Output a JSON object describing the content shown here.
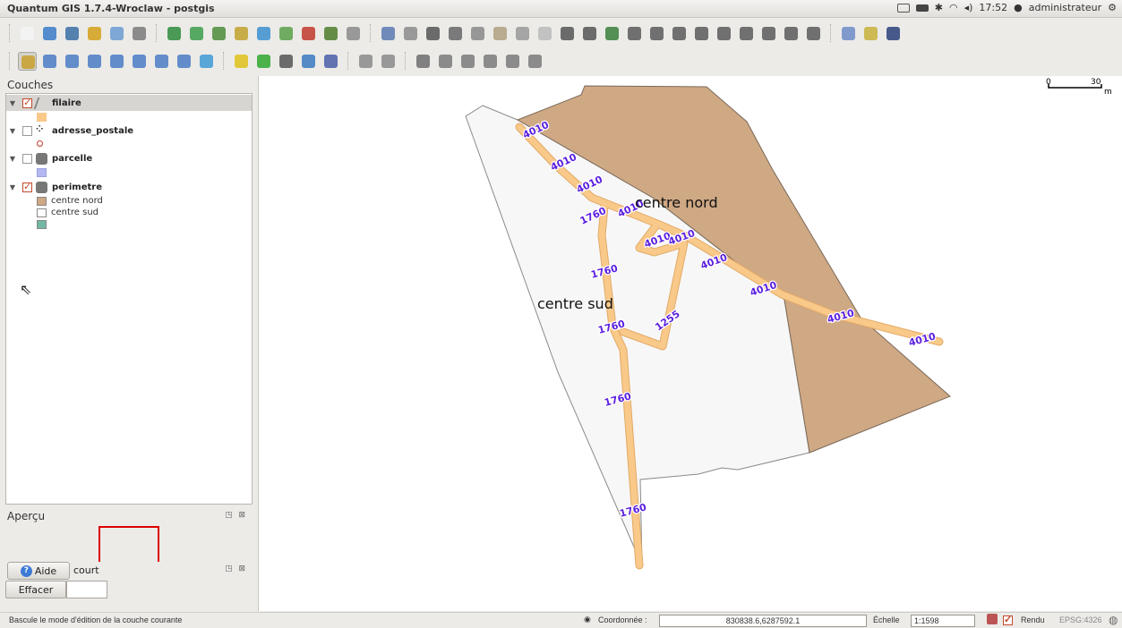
{
  "window": {
    "title": "Quantum GIS 1.7.4-Wroclaw - postgis"
  },
  "tray": {
    "time": "17:52",
    "user": "administrateur"
  },
  "toolbar1": {
    "icons": [
      "new-project-icon",
      "open-project-icon",
      "save-project-icon",
      "save-as-icon",
      "print-composer-icon",
      "print-icon",
      "add-vector-icon",
      "add-raster-icon",
      "add-postgis-icon",
      "add-spatialite-icon",
      "add-wms-icon",
      "new-shapefile-icon",
      "remove-layer-icon",
      "add-wfs-icon",
      "add-gps-icon",
      "toggle-edit-icon",
      "save-edits-icon",
      "move-feature-icon",
      "node-tool-icon",
      "delete-selected-icon",
      "cut-icon",
      "copy-icon",
      "paste-icon",
      "undo-icon",
      "redo-icon",
      "add-ring-icon",
      "add-part-icon",
      "fill-ring-icon",
      "delete-ring-icon",
      "delete-part-icon",
      "reshape-icon",
      "split-icon",
      "merge-icon",
      "merge-attributes-icon",
      "rotate-icon",
      "plugin-icon",
      "select-icon",
      "whats-this-icon"
    ],
    "colors": [
      "#f5f5f5",
      "#3b7bc8",
      "#3b6ea5",
      "#d4a017",
      "#6b9bd1",
      "#7a7a7a",
      "#2e8b3a",
      "#3c9d4a",
      "#4d8c3a",
      "#c2a12a",
      "#3c8fd0",
      "#5aa04a",
      "#c13a2c",
      "#4d7c2a",
      "#8a8a8a",
      "#5a7ab0",
      "#8b8b8b",
      "#555555",
      "#666666",
      "#888888",
      "#b0a080",
      "#999999",
      "#bbbbbb",
      "#555555",
      "#555555",
      "#3a7f38",
      "#5a5a5a",
      "#5a5a5a",
      "#5a5a5a",
      "#5a5a5a",
      "#5a5a5a",
      "#5a5a5a",
      "#5a5a5a",
      "#5a5a5a",
      "#5a5a5a",
      "#6d8cc7",
      "#c8b23a",
      "#2a3f7a"
    ]
  },
  "toolbar2": {
    "icons": [
      "pan-icon",
      "zoom-in-icon",
      "zoom-out-icon",
      "zoom-full-icon",
      "zoom-layer-icon",
      "zoom-selection-icon",
      "zoom-last-icon",
      "zoom-next-icon",
      "refresh-icon",
      "identify-icon",
      "select-features-icon",
      "deselect-icon",
      "measure-line-icon",
      "map-tips-icon",
      "new-bookmark-icon",
      "show-bookmarks-icon",
      "label-icon",
      "pin-labels-icon",
      "show-hide-labels-icon",
      "move-label-icon",
      "rotate-label-icon",
      "change-label-icon"
    ],
    "colors": [
      "#c8a02a",
      "#4a7bc4",
      "#4a7bc4",
      "#4a7bc4",
      "#4a7bc4",
      "#4a7bc4",
      "#4a7bc4",
      "#4a7bc4",
      "#3f9ad6",
      "#e0c21a",
      "#2fa82f",
      "#555555",
      "#3a7ac0",
      "#4a5ea8",
      "#8a8a8a",
      "#8a8a8a",
      "#6d6d6d",
      "#7a7a7a",
      "#7a7a7a",
      "#7a7a7a",
      "#7a7a7a",
      "#7a7a7a"
    ]
  },
  "layers_panel": {
    "title": "Couches",
    "layers": [
      {
        "name": "filaire",
        "checked": true,
        "legend": [
          {
            "label": "",
            "color": "#f9c98a"
          }
        ]
      },
      {
        "name": "adresse_postale",
        "checked": false,
        "legend": [
          {
            "label": "",
            "color": "#c0392b"
          }
        ]
      },
      {
        "name": "parcelle",
        "checked": false,
        "legend": [
          {
            "label": "",
            "color": "#b4b8f0"
          }
        ]
      },
      {
        "name": "perimetre",
        "checked": true,
        "legend": [
          {
            "label": "centre nord",
            "color": "#cfa884"
          },
          {
            "label": "centre sud",
            "color": "#ffffff"
          },
          {
            "label": "",
            "color": "#72b8a4"
          }
        ]
      }
    ]
  },
  "apercu_panel": {
    "title": "Aperçu"
  },
  "raccourci": {
    "help_label": "Aide",
    "title_fragment": "court",
    "clear_label": "Effacer"
  },
  "map": {
    "scalebar": {
      "start": "0",
      "end": "30",
      "unit": "m"
    },
    "zone_labels": [
      "centre nord",
      "centre sud"
    ],
    "segment_labels": [
      "4010",
      "4010",
      "4010",
      "4010",
      "4010",
      "4010",
      "4010",
      "4010",
      "4010",
      "4010",
      "1760",
      "1760",
      "1760",
      "1760",
      "1760",
      "1255"
    ],
    "colors": {
      "nord": "#cfa884",
      "sud": "#f5f5f5",
      "line": "#f9c98a",
      "line_edge": "#e2aa66",
      "label": "#5b1fe0"
    }
  },
  "statusbar": {
    "message": "Bascule le mode d'édition de la couche courante",
    "coord_label": "Coordonnée :",
    "coord_value": "830838.6,6287592.1",
    "scale_label": "Échelle",
    "scale_value": "1:1598",
    "render_label": "Rendu",
    "crs": "EPSG:4326"
  }
}
